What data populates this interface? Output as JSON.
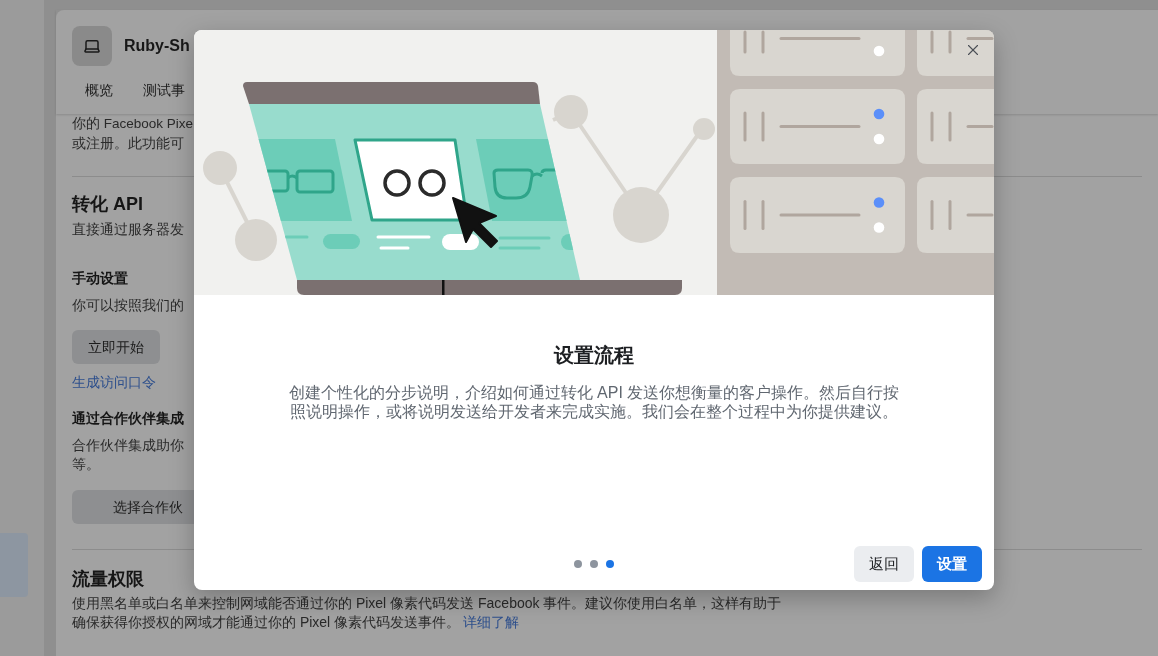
{
  "page": {
    "header": {
      "title": "Ruby-Sh"
    },
    "tabs": [
      {
        "label": "概览"
      },
      {
        "label": "测试事"
      }
    ],
    "intro": {
      "lines": [
        "你的 Facebook Pixe",
        "或注册。此功能可"
      ]
    },
    "conversions_api": {
      "title": "转化 API",
      "description": "直接通过服务器发",
      "manual_setup": {
        "title": "手动设置",
        "description": "你可以按照我们的",
        "button": "立即开始",
        "link": "生成访问口令"
      },
      "partner_setup": {
        "title": "通过合作伙伴集成",
        "description_lines": [
          "合作伙伴集成助你",
          "等。"
        ],
        "button": "选择合作伙"
      }
    },
    "traffic_permissions": {
      "title": "流量权限",
      "description": "使用黑名单或白名单来控制网域能否通过你的 Pixel 像素代码发送 Facebook 事件。建议你使用白名单，这样有助于确保获得你授权的网域才能通过你的 Pixel 像素代码发送事件。",
      "link": "详细了解"
    }
  },
  "dialog": {
    "title": "设置流程",
    "description": "创建个性化的分步说明，介绍如何通过转化 API 发送你想衡量的客户操作。然后自行按照说明操作，或将说明发送给开发者来完成实施。我们会在整个过程中为你提供建议。",
    "steps": [
      {
        "selected": false
      },
      {
        "selected": false
      },
      {
        "selected": true
      }
    ],
    "buttons": [
      {
        "label": "返回",
        "kind": "secondary"
      },
      {
        "label": "设置",
        "kind": "primary"
      }
    ]
  }
}
